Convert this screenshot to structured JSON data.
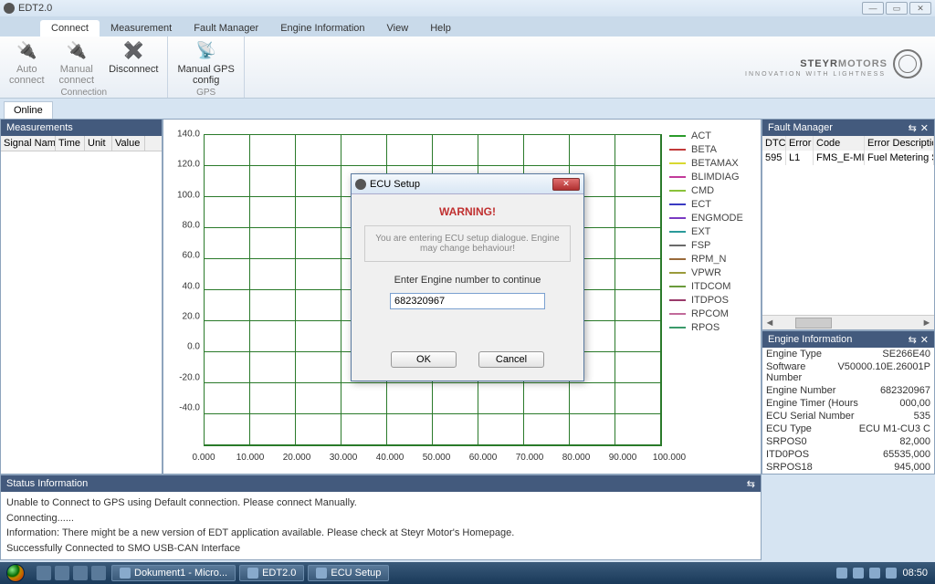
{
  "window": {
    "title": "EDT2.0"
  },
  "menu": {
    "tabs": [
      "Connect",
      "Measurement",
      "Fault Manager",
      "Engine Information",
      "View",
      "Help"
    ],
    "active": 0
  },
  "ribbon": {
    "groups": [
      {
        "label": "Connection",
        "buttons": [
          {
            "label": "Auto\nconnect",
            "enabled": false
          },
          {
            "label": "Manual\nconnect",
            "enabled": false
          },
          {
            "label": "Disconnect",
            "enabled": true
          }
        ]
      },
      {
        "label": "GPS",
        "buttons": [
          {
            "label": "Manual GPS\nconfig",
            "enabled": true
          }
        ]
      }
    ]
  },
  "brand": {
    "name": "STEYR",
    "name2": "MOTORS",
    "tag": "INNOVATION WITH LIGHTNESS"
  },
  "onlinetab": "Online",
  "meas": {
    "title": "Measurements",
    "cols": [
      "Signal Name",
      "Time",
      "Unit",
      "Value"
    ]
  },
  "chart_data": {
    "type": "line",
    "xlabel": "",
    "ylabel": "",
    "xticks": [
      "0.000",
      "10.000",
      "20.000",
      "30.000",
      "40.000",
      "50.000",
      "60.000",
      "70.000",
      "80.000",
      "90.000",
      "100.000"
    ],
    "yticks": [
      "140.0",
      "120.0",
      "100.0",
      "80.0",
      "60.0",
      "40.0",
      "20.0",
      "0.0",
      "-20.0",
      "-40.0"
    ],
    "xlim": [
      0,
      100
    ],
    "ylim": [
      -40,
      140
    ],
    "series": [
      {
        "name": "ACT",
        "color": "#2a9a2a"
      },
      {
        "name": "BETA",
        "color": "#c23a3a"
      },
      {
        "name": "BETAMAX",
        "color": "#d8d830"
      },
      {
        "name": "BLIMDIAG",
        "color": "#c23a9a"
      },
      {
        "name": "CMD",
        "color": "#8ac23a"
      },
      {
        "name": "ECT",
        "color": "#3a3ac2"
      },
      {
        "name": "ENGMODE",
        "color": "#7a3ac2"
      },
      {
        "name": "EXT",
        "color": "#2a9a9a"
      },
      {
        "name": "FSP",
        "color": "#6a6a6a"
      },
      {
        "name": "RPM_N",
        "color": "#9a6a3a"
      },
      {
        "name": "VPWR",
        "color": "#9a9a3a"
      },
      {
        "name": "ITDCOM",
        "color": "#6a9a3a"
      },
      {
        "name": "ITDPOS",
        "color": "#9a3a6a"
      },
      {
        "name": "RPCOM",
        "color": "#c26a9a"
      },
      {
        "name": "RPOS",
        "color": "#3a9a6a"
      }
    ]
  },
  "fault": {
    "title": "Fault Manager",
    "cols": [
      "DTC",
      "Error",
      "Code",
      "Error Description"
    ],
    "rows": [
      {
        "dtc": "595",
        "err": "L1",
        "code": "FMS_E-MIN",
        "desc": "Fuel Metering So"
      }
    ]
  },
  "enginfo": {
    "title": "Engine Information",
    "rows": [
      {
        "k": "Engine Type",
        "v": "SE266E40"
      },
      {
        "k": "Software Number",
        "v": "V50000.10E.26001P"
      },
      {
        "k": "Engine Number",
        "v": "682320967"
      },
      {
        "k": "Engine Timer (Hours",
        "v": "000,00"
      },
      {
        "k": "ECU Serial Number",
        "v": "535"
      },
      {
        "k": "ECU Type",
        "v": "ECU M1-CU3 C"
      },
      {
        "k": "SRPOS0",
        "v": "82,000"
      },
      {
        "k": "ITD0POS",
        "v": "65535,000"
      },
      {
        "k": "SRPOS18",
        "v": "945,000"
      }
    ]
  },
  "status": {
    "title": "Status Information",
    "lines": [
      "Unable to Connect to GPS using Default connection. Please connect Manually.",
      "Connecting......",
      "Information: There might be a new version of EDT application available. Please check at Steyr Motor's Homepage.",
      "Successfully Connected to SMO USB-CAN Interface"
    ]
  },
  "modal": {
    "title": "ECU Setup",
    "warn": "WARNING!",
    "msg": "You are entering ECU setup dialogue. Engine may change behaviour!",
    "prompt": "Enter Engine number to continue",
    "value": "682320967",
    "ok": "OK",
    "cancel": "Cancel"
  },
  "taskbar": {
    "tasks": [
      "Dokument1 - Micro...",
      "EDT2.0",
      "ECU Setup"
    ],
    "time": "08:50"
  }
}
